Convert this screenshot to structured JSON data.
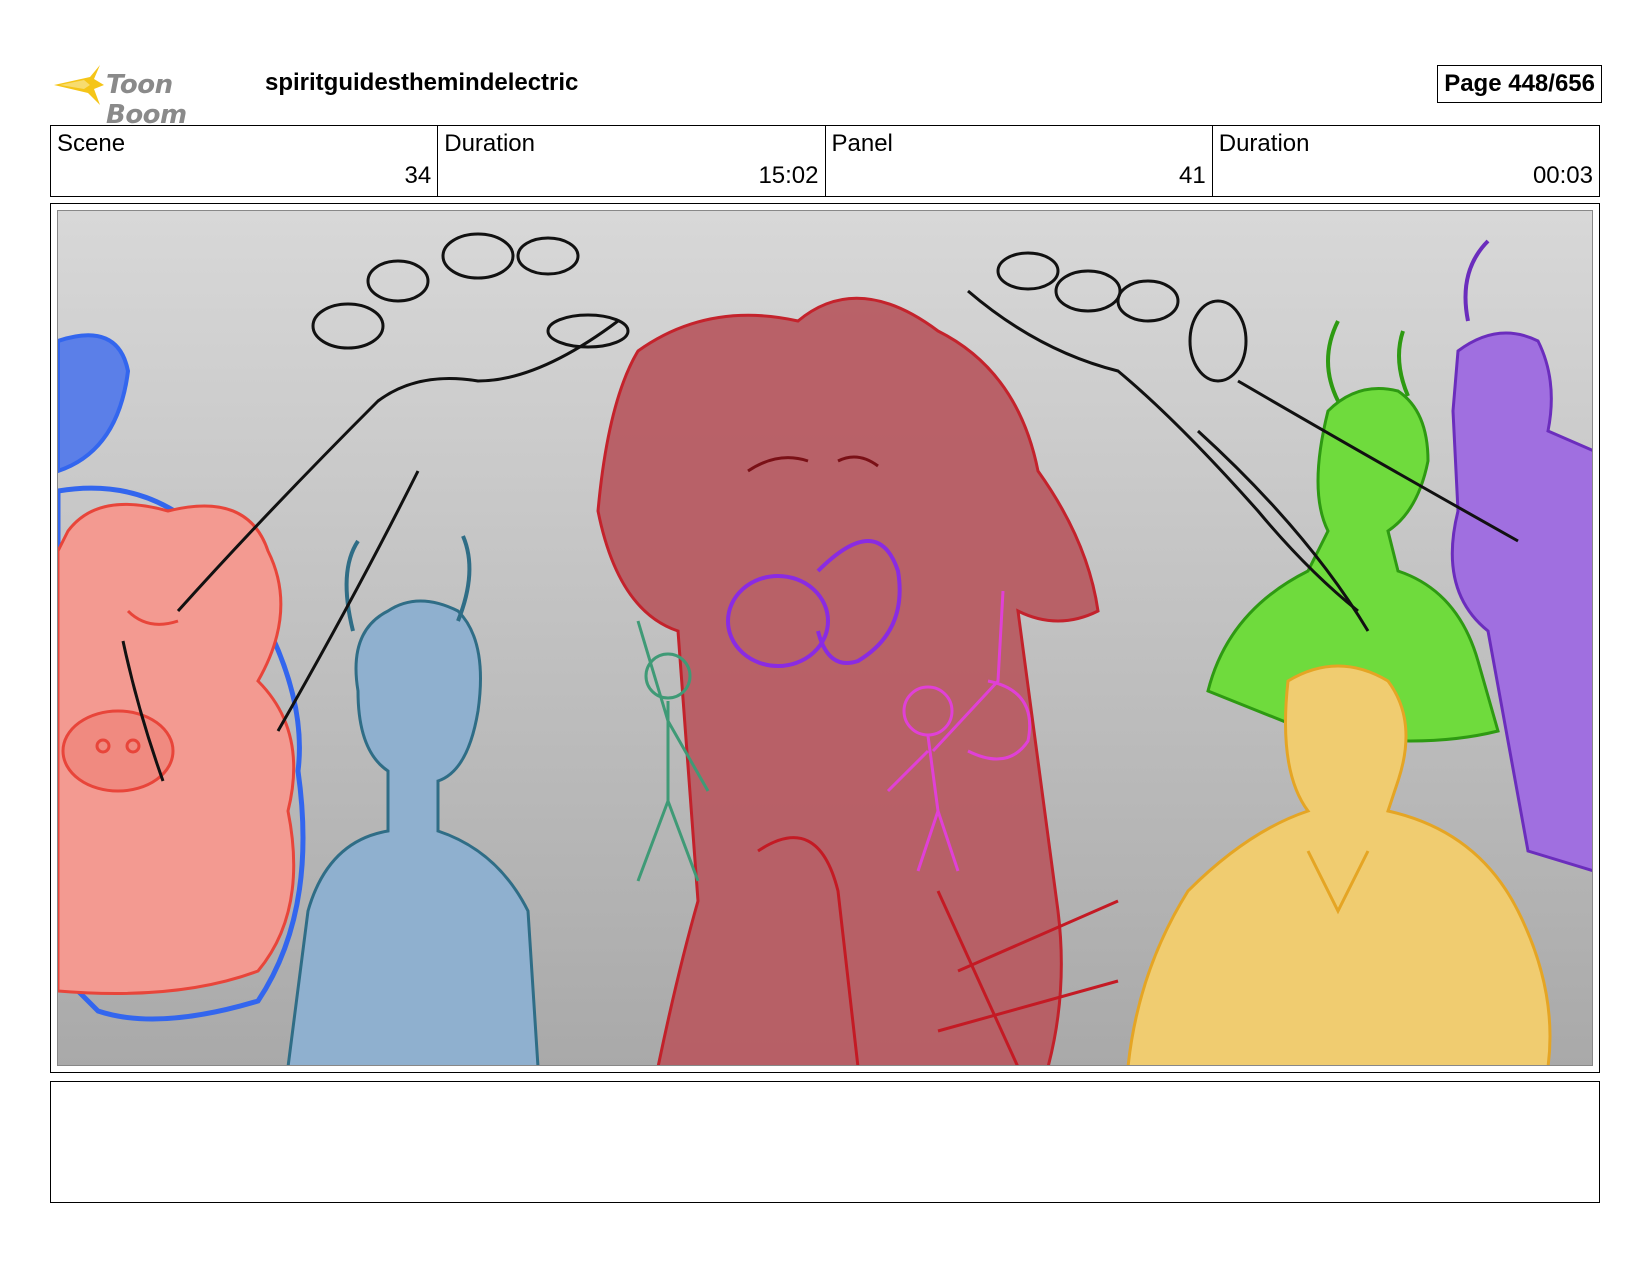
{
  "header": {
    "logo_text": "Toon Boom",
    "project_title": "spiritguidesthemindelectric",
    "page_label": "Page 448/656"
  },
  "info": {
    "scene_label": "Scene",
    "scene_value": "34",
    "scene_duration_label": "Duration",
    "scene_duration_value": "15:02",
    "panel_label": "Panel",
    "panel_value": "41",
    "panel_duration_label": "Duration",
    "panel_duration_value": "00:03"
  },
  "panel": {
    "description": "",
    "colors": {
      "red_demon": "#b85c63",
      "blue_figure": "#8fb0cf",
      "pink_figure": "#f39a91",
      "blue_outline": "#3366ee",
      "green_figure": "#6fdb3d",
      "purple_figure": "#a06fe0",
      "yellow_figure": "#f0cc70",
      "teal_sketch": "#3f9a76",
      "magenta_sketch": "#e040d6",
      "violet_sketch": "#8a2be2"
    }
  },
  "notes": {
    "text": ""
  }
}
